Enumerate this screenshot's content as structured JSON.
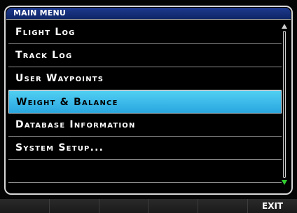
{
  "menu": {
    "title": "MAIN MENU",
    "items": [
      {
        "label": "Flight Log",
        "selected": false
      },
      {
        "label": "Track Log",
        "selected": false
      },
      {
        "label": "User Waypoints",
        "selected": false
      },
      {
        "label": "Weight & Balance",
        "selected": true
      },
      {
        "label": "Database Information",
        "selected": false
      },
      {
        "label": "System Setup...",
        "selected": false
      },
      {
        "label": "",
        "selected": false
      }
    ]
  },
  "softkeys": [
    "",
    "",
    "",
    "",
    "",
    "EXIT"
  ],
  "colors": {
    "title_bar": "#1e3a8e",
    "selection": "#3bbbea",
    "scroll_down_arrow": "#32cd32"
  }
}
